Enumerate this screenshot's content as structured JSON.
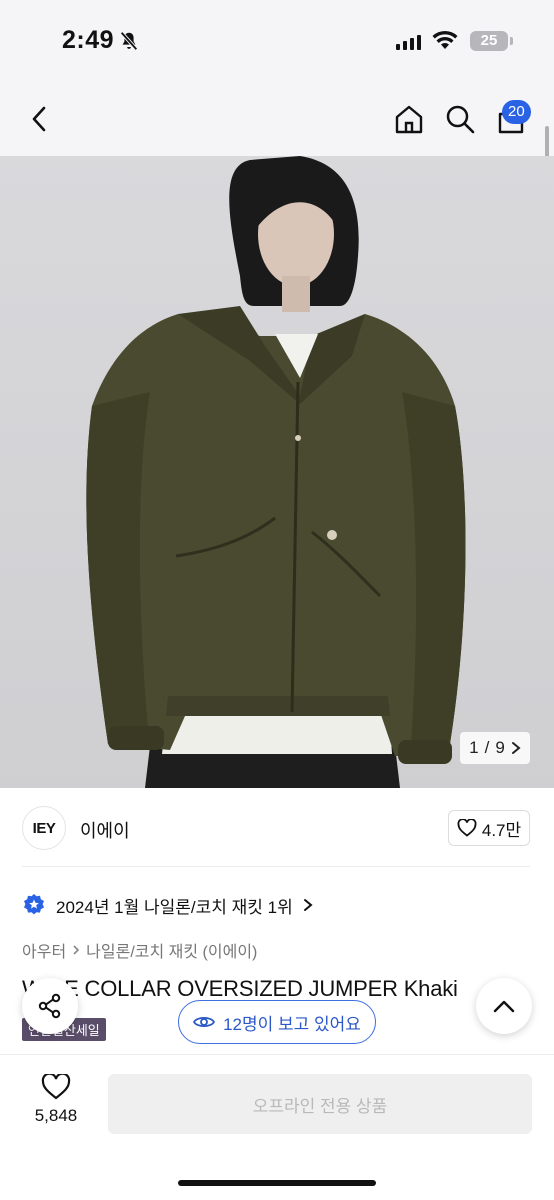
{
  "status_bar": {
    "time": "2:49",
    "battery": "25"
  },
  "nav": {
    "cart_count": "20"
  },
  "gallery": {
    "current": "1",
    "separator": "/",
    "total": "9"
  },
  "brand": {
    "logo_text": "IEY",
    "name": "이에이",
    "likes": "4.7만"
  },
  "ranking": {
    "text": "2024년 1월 나일론/코치 재킷 1위"
  },
  "breadcrumb": {
    "category": "아우터",
    "subcategory": "나일론/코치 재킷 (이에이)"
  },
  "product": {
    "title": "WIDE COLLAR OVERSIZED JUMPER Khaki",
    "sale_tag": "연말결산세일"
  },
  "viewers": {
    "text": "12명이 보고 있어요"
  },
  "bottom": {
    "wish_count": "5,848",
    "buy_label": "오프라인 전용 상품"
  },
  "colors": {
    "accent": "#2a62e6",
    "jacket": "#4a4a30",
    "sale_tag_bg": "#5a4d6a"
  }
}
